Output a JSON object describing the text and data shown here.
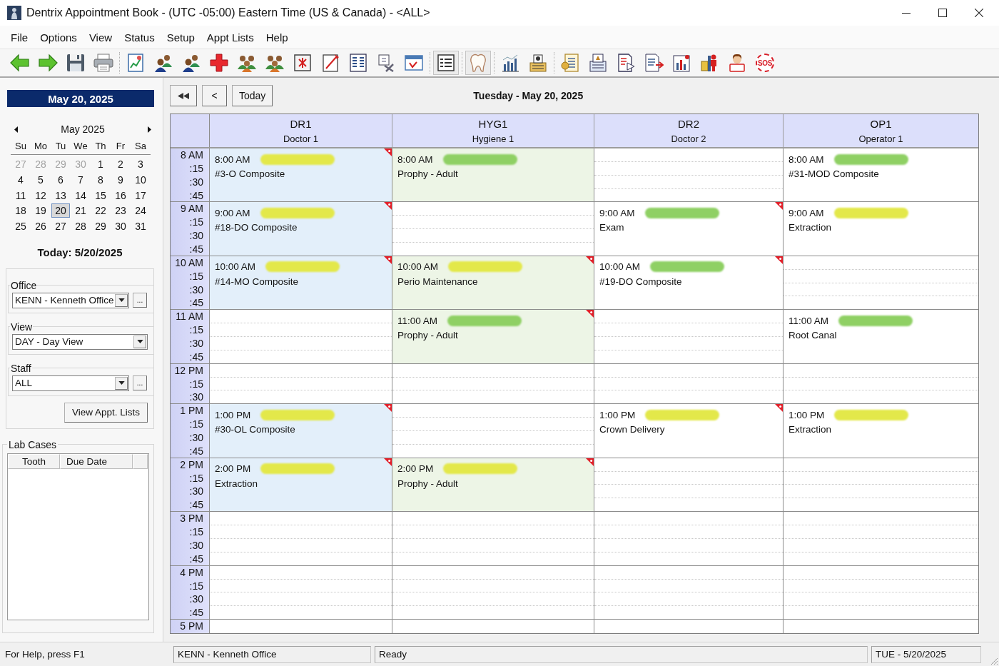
{
  "window": {
    "title": "Dentrix Appointment Book - (UTC -05:00) Eastern Time (US & Canada) - <ALL>"
  },
  "menu": [
    "File",
    "Options",
    "View",
    "Status",
    "Setup",
    "Appt Lists",
    "Help"
  ],
  "toolbar": {
    "groups": [
      [
        {
          "pressed": false
        },
        {
          "pressed": false
        },
        {
          "pressed": false
        },
        {
          "pressed": false
        }
      ],
      [
        {
          "pressed": false
        },
        {
          "pressed": false
        },
        {
          "pressed": false
        },
        {
          "pressed": false
        },
        {
          "pressed": false
        },
        {
          "pressed": false
        },
        {
          "pressed": false
        },
        {
          "pressed": false
        },
        {
          "pressed": false
        },
        {
          "pressed": false
        },
        {
          "pressed": false
        }
      ],
      [
        {
          "pressed": true
        }
      ],
      [
        {
          "pressed": true
        }
      ],
      [
        {
          "pressed": false
        },
        {
          "pressed": false
        }
      ],
      [
        {
          "pressed": false
        },
        {
          "pressed": false
        },
        {
          "pressed": false
        },
        {
          "pressed": false
        },
        {
          "pressed": false
        },
        {
          "pressed": false
        },
        {
          "pressed": false
        },
        {
          "pressed": false,
          "label": "SOS"
        }
      ]
    ]
  },
  "sidebar": {
    "date_header": "May 20, 2025",
    "calendar": {
      "month": "May 2025",
      "weekdays": [
        "Su",
        "Mo",
        "Tu",
        "We",
        "Th",
        "Fr",
        "Sa"
      ],
      "weeks": [
        [
          {
            "day": "27",
            "other_month": true,
            "selected": false
          },
          {
            "day": "28",
            "other_month": true,
            "selected": false
          },
          {
            "day": "29",
            "other_month": true,
            "selected": false
          },
          {
            "day": "30",
            "other_month": true,
            "selected": false
          },
          {
            "day": "1",
            "other_month": false,
            "selected": false
          },
          {
            "day": "2",
            "other_month": false,
            "selected": false
          },
          {
            "day": "3",
            "other_month": false,
            "selected": false
          }
        ],
        [
          {
            "day": "4",
            "other_month": false,
            "selected": false
          },
          {
            "day": "5",
            "other_month": false,
            "selected": false
          },
          {
            "day": "6",
            "other_month": false,
            "selected": false
          },
          {
            "day": "7",
            "other_month": false,
            "selected": false
          },
          {
            "day": "8",
            "other_month": false,
            "selected": false
          },
          {
            "day": "9",
            "other_month": false,
            "selected": false
          },
          {
            "day": "10",
            "other_month": false,
            "selected": false
          }
        ],
        [
          {
            "day": "11",
            "other_month": false,
            "selected": false
          },
          {
            "day": "12",
            "other_month": false,
            "selected": false
          },
          {
            "day": "13",
            "other_month": false,
            "selected": false
          },
          {
            "day": "14",
            "other_month": false,
            "selected": false
          },
          {
            "day": "15",
            "other_month": false,
            "selected": false
          },
          {
            "day": "16",
            "other_month": false,
            "selected": false
          },
          {
            "day": "17",
            "other_month": false,
            "selected": false
          }
        ],
        [
          {
            "day": "18",
            "other_month": false,
            "selected": false
          },
          {
            "day": "19",
            "other_month": false,
            "selected": false
          },
          {
            "day": "20",
            "other_month": false,
            "selected": true
          },
          {
            "day": "21",
            "other_month": false,
            "selected": false
          },
          {
            "day": "22",
            "other_month": false,
            "selected": false
          },
          {
            "day": "23",
            "other_month": false,
            "selected": false
          },
          {
            "day": "24",
            "other_month": false,
            "selected": false
          }
        ],
        [
          {
            "day": "25",
            "other_month": false,
            "selected": false
          },
          {
            "day": "26",
            "other_month": false,
            "selected": false
          },
          {
            "day": "27",
            "other_month": false,
            "selected": false
          },
          {
            "day": "28",
            "other_month": false,
            "selected": false
          },
          {
            "day": "29",
            "other_month": false,
            "selected": false
          },
          {
            "day": "30",
            "other_month": false,
            "selected": false
          },
          {
            "day": "31",
            "other_month": false,
            "selected": false
          }
        ]
      ]
    },
    "today": "Today: 5/20/2025",
    "office": {
      "label": "Office",
      "value": "KENN - Kenneth Office",
      "more": "..."
    },
    "view": {
      "label": "View",
      "value": "DAY - Day View"
    },
    "staff": {
      "label": "Staff",
      "value": "ALL",
      "more": "..."
    },
    "lists_button": "View Appt. Lists",
    "lab_cases": {
      "title": "Lab Cases",
      "columns": [
        "Tooth",
        "Due Date"
      ]
    }
  },
  "navigation": [
    {
      "kind": "first"
    },
    {
      "kind": "label",
      "label": "<"
    },
    {
      "kind": "label",
      "label": "Today"
    }
  ],
  "date_title": "Tuesday - May 20, 2025",
  "schedule": {
    "columns": [
      {
        "code": "DR1",
        "name": "Doctor 1"
      },
      {
        "code": "HYG1",
        "name": "Hygiene 1"
      },
      {
        "code": "DR2",
        "name": "Doctor 2"
      },
      {
        "code": "OP1",
        "name": "Operator 1"
      }
    ],
    "rows": [
      {
        "hour": "8 AM",
        "marks": [
          ":15",
          ":30",
          ":45"
        ],
        "cells": [
          {
            "kind": "appointment",
            "time": "8:00 AM",
            "procedure": "#3-O Composite",
            "color": "#e3effa",
            "highlight": {
              "color": "#e3e84a"
            },
            "flagged": true
          },
          {
            "kind": "appointment",
            "time": "8:00 AM",
            "procedure": "Prophy - Adult",
            "color": "#edf5e6",
            "highlight": {
              "color": "#8fd064"
            },
            "flagged": false
          },
          {
            "kind": "open"
          },
          {
            "kind": "appointment",
            "time": "8:00 AM",
            "procedure": "#31-MOD Composite",
            "color": "#ffffff",
            "highlight": {
              "color": "#8fd064"
            },
            "flagged": false
          }
        ]
      },
      {
        "hour": "9 AM",
        "marks": [
          ":15",
          ":30",
          ":45"
        ],
        "cells": [
          {
            "kind": "appointment",
            "time": "9:00 AM",
            "procedure": "#18-DO Composite",
            "color": "#e3effa",
            "highlight": {
              "color": "#e3e84a"
            },
            "flagged": true
          },
          {
            "kind": "open"
          },
          {
            "kind": "appointment",
            "time": "9:00 AM",
            "procedure": "Exam",
            "color": "#ffffff",
            "highlight": {
              "color": "#8fd064"
            },
            "flagged": true
          },
          {
            "kind": "appointment",
            "time": "9:00 AM",
            "procedure": "Extraction",
            "color": "#ffffff",
            "highlight": {
              "color": "#e3e84a"
            },
            "flagged": false
          }
        ]
      },
      {
        "hour": "10 AM",
        "marks": [
          ":15",
          ":30",
          ":45"
        ],
        "cells": [
          {
            "kind": "appointment",
            "time": "10:00 AM",
            "procedure": "#14-MO Composite",
            "color": "#e3effa",
            "highlight": {
              "color": "#e3e84a"
            },
            "flagged": true
          },
          {
            "kind": "appointment",
            "time": "10:00 AM",
            "procedure": "Perio Maintenance",
            "color": "#edf5e6",
            "highlight": {
              "color": "#e3e84a"
            },
            "flagged": true
          },
          {
            "kind": "appointment",
            "time": "10:00 AM",
            "procedure": "#19-DO Composite",
            "color": "#ffffff",
            "highlight": {
              "color": "#8fd064"
            },
            "flagged": true
          },
          {
            "kind": "open"
          }
        ]
      },
      {
        "hour": "11 AM",
        "marks": [
          ":15",
          ":30",
          ":45"
        ],
        "cells": [
          {
            "kind": "open"
          },
          {
            "kind": "appointment",
            "time": "11:00 AM",
            "procedure": "Prophy - Adult",
            "color": "#edf5e6",
            "highlight": {
              "color": "#8fd064"
            },
            "flagged": true
          },
          {
            "kind": "open"
          },
          {
            "kind": "appointment",
            "time": "11:00 AM",
            "procedure": "Root Canal",
            "color": "#ffffff",
            "highlight": {
              "color": "#8fd064"
            },
            "flagged": false
          }
        ]
      },
      {
        "hour": "12 PM",
        "marks": [
          ":15",
          ":30"
        ],
        "cells": [
          {
            "kind": "open"
          },
          {
            "kind": "open"
          },
          {
            "kind": "open"
          },
          {
            "kind": "open"
          }
        ]
      },
      {
        "hour": "1 PM",
        "marks": [
          ":15",
          ":30",
          ":45"
        ],
        "cells": [
          {
            "kind": "appointment",
            "time": "1:00 PM",
            "procedure": "#30-OL Composite",
            "color": "#e3effa",
            "highlight": {
              "color": "#e3e84a"
            },
            "flagged": true
          },
          {
            "kind": "open"
          },
          {
            "kind": "appointment",
            "time": "1:00 PM",
            "procedure": "Crown Delivery",
            "color": "#ffffff",
            "highlight": {
              "color": "#e3e84a"
            },
            "flagged": true
          },
          {
            "kind": "appointment",
            "time": "1:00 PM",
            "procedure": "Extraction",
            "color": "#ffffff",
            "highlight": {
              "color": "#e3e84a"
            },
            "flagged": false
          }
        ]
      },
      {
        "hour": "2 PM",
        "marks": [
          ":15",
          ":30",
          ":45"
        ],
        "cells": [
          {
            "kind": "appointment",
            "time": "2:00 PM",
            "procedure": "Extraction",
            "color": "#e3effa",
            "highlight": {
              "color": "#e3e84a"
            },
            "flagged": true
          },
          {
            "kind": "appointment",
            "time": "2:00 PM",
            "procedure": "Prophy - Adult",
            "color": "#edf5e6",
            "highlight": {
              "color": "#e3e84a"
            },
            "flagged": true
          },
          {
            "kind": "open"
          },
          {
            "kind": "open"
          }
        ]
      },
      {
        "hour": "3 PM",
        "marks": [
          ":15",
          ":30",
          ":45"
        ],
        "cells": [
          {
            "kind": "open"
          },
          {
            "kind": "open"
          },
          {
            "kind": "open"
          },
          {
            "kind": "open"
          }
        ]
      },
      {
        "hour": "4 PM",
        "marks": [
          ":15",
          ":30",
          ":45"
        ],
        "cells": [
          {
            "kind": "open"
          },
          {
            "kind": "open"
          },
          {
            "kind": "open"
          },
          {
            "kind": "open"
          }
        ]
      },
      {
        "hour": "5 PM",
        "marks": [],
        "cells": [
          {
            "kind": "open"
          },
          {
            "kind": "open"
          },
          {
            "kind": "open"
          },
          {
            "kind": "open"
          }
        ]
      }
    ]
  },
  "status_bar": [
    {
      "kind": "plain",
      "text": "For Help, press F1"
    },
    {
      "kind": "panel",
      "text": "KENN - Kenneth Office"
    },
    {
      "kind": "panel",
      "text": "Ready"
    },
    {
      "kind": "panel",
      "text": "TUE - 5/20/2025"
    }
  ]
}
